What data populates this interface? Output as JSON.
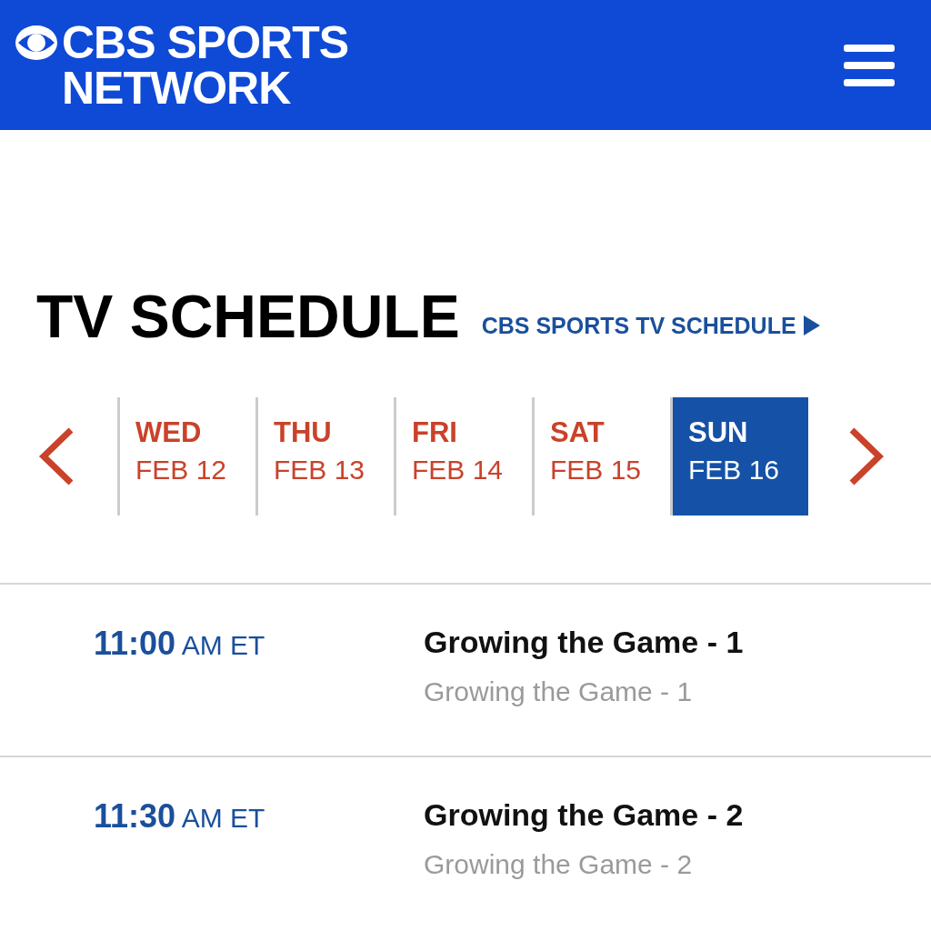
{
  "header": {
    "logo_line_1": "CBS SPORTS",
    "logo_line_2": "NETWORK"
  },
  "title": "TV SCHEDULE",
  "schedule_link": "CBS SPORTS TV SCHEDULE",
  "days": [
    {
      "day": "WED",
      "date": "FEB 12",
      "selected": false
    },
    {
      "day": "THU",
      "date": "FEB 13",
      "selected": false
    },
    {
      "day": "FRI",
      "date": "FEB 14",
      "selected": false
    },
    {
      "day": "SAT",
      "date": "FEB 15",
      "selected": false
    },
    {
      "day": "SUN",
      "date": "FEB 16",
      "selected": true
    }
  ],
  "programs": [
    {
      "time": "**11:00** AM ET",
      "title": "Growing the Game - 1",
      "subtitle": "Growing the Game - 1"
    },
    {
      "time": "**11:30** AM ET",
      "title": "Growing the Game - 2",
      "subtitle": "Growing the Game - 2"
    }
  ]
}
